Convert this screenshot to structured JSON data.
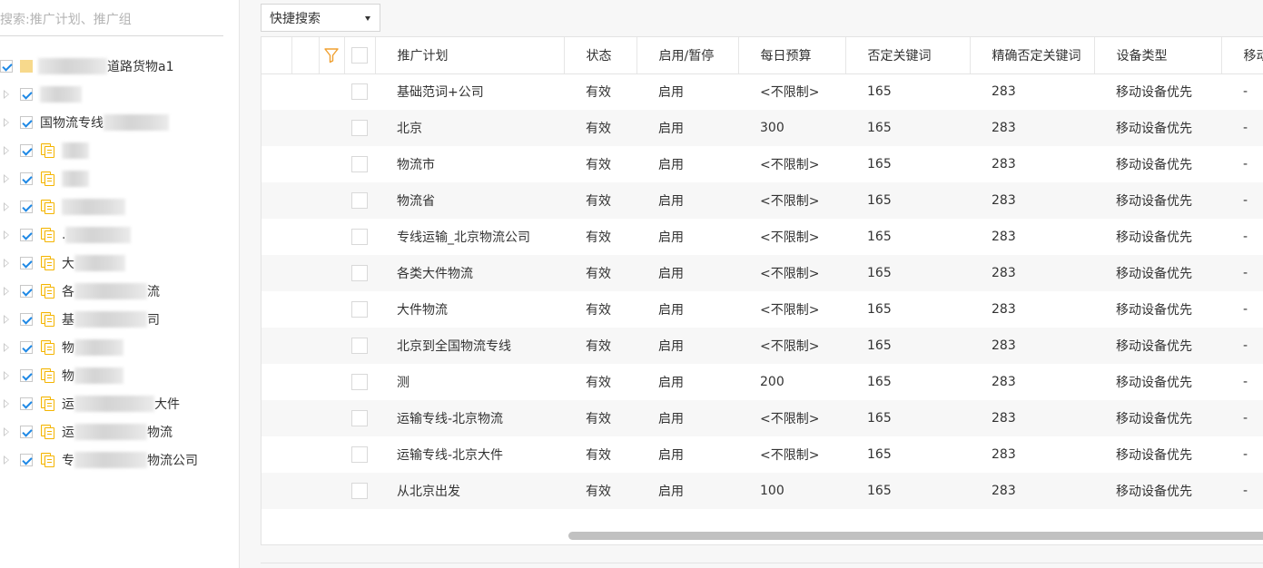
{
  "sidebar": {
    "search_placeholder": "搜索:推广计划、推广组",
    "root_label": "道路货物a1",
    "items": [
      {
        "label": ""
      },
      {
        "label": "国物流专线"
      },
      {
        "label": ""
      },
      {
        "label": ""
      },
      {
        "label": ""
      },
      {
        "label": "."
      },
      {
        "label": "大"
      },
      {
        "label": "各",
        "suffix": "流"
      },
      {
        "label": "基",
        "suffix": "司"
      },
      {
        "label": "物"
      },
      {
        "label": "物"
      },
      {
        "label": "运",
        "suffix": "大件"
      },
      {
        "label": "运",
        "suffix": "物流"
      },
      {
        "label": "专",
        "suffix": "物流公司"
      }
    ]
  },
  "toolbar": {
    "quick_search_label": "快捷搜索"
  },
  "table": {
    "columns": [
      "推广计划",
      "状态",
      "启用/暂停",
      "每日预算",
      "否定关键词",
      "精确否定关键词",
      "设备类型",
      "移动"
    ],
    "rows": [
      [
        "基础范词+公司",
        "有效",
        "启用",
        "<不限制>",
        "165",
        "283",
        "移动设备优先",
        "-"
      ],
      [
        "北京",
        "有效",
        "启用",
        "300",
        "165",
        "283",
        "移动设备优先",
        "-"
      ],
      [
        "物流市",
        "有效",
        "启用",
        "<不限制>",
        "165",
        "283",
        "移动设备优先",
        "-"
      ],
      [
        "物流省",
        "有效",
        "启用",
        "<不限制>",
        "165",
        "283",
        "移动设备优先",
        "-"
      ],
      [
        "专线运输_北京物流公司",
        "有效",
        "启用",
        "<不限制>",
        "165",
        "283",
        "移动设备优先",
        "-"
      ],
      [
        "各类大件物流",
        "有效",
        "启用",
        "<不限制>",
        "165",
        "283",
        "移动设备优先",
        "-"
      ],
      [
        "大件物流",
        "有效",
        "启用",
        "<不限制>",
        "165",
        "283",
        "移动设备优先",
        "-"
      ],
      [
        "北京到全国物流专线",
        "有效",
        "启用",
        "<不限制>",
        "165",
        "283",
        "移动设备优先",
        "-"
      ],
      [
        "测",
        "有效",
        "启用",
        "200",
        "165",
        "283",
        "移动设备优先",
        "-"
      ],
      [
        "运输专线-北京物流",
        "有效",
        "启用",
        "<不限制>",
        "165",
        "283",
        "移动设备优先",
        "-"
      ],
      [
        "运输专线-北京大件",
        "有效",
        "启用",
        "<不限制>",
        "165",
        "283",
        "移动设备优先",
        "-"
      ],
      [
        "从北京出发",
        "有效",
        "启用",
        "100",
        "165",
        "283",
        "移动设备优先",
        "-"
      ]
    ]
  },
  "colors": {
    "accent_blue": "#1e88e5",
    "folder_yellow": "#f4b400",
    "filter_orange": "#f0a030"
  }
}
